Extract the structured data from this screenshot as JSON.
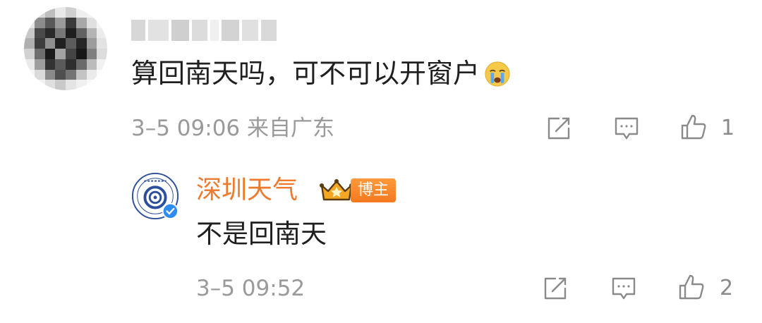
{
  "comment": {
    "avatar_icon": "pixelated-avatar",
    "text": "算回南天吗，可不可以开窗户",
    "emoji": "crying-face",
    "meta": "3–5 09:06 来自广东",
    "like_count": "1"
  },
  "reply": {
    "author": "深圳天气",
    "badge": "博主",
    "text": "不是回南天",
    "meta": "3–5 09:52",
    "like_count": "2"
  },
  "colors": {
    "accent_orange": "#ee7a2d",
    "meta_gray": "#9a9a9a",
    "icon_gray": "#8a8a8a"
  }
}
